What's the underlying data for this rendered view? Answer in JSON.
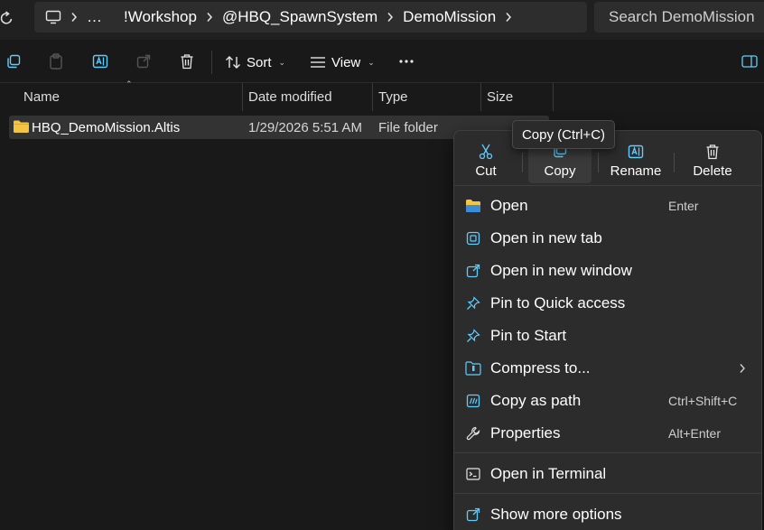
{
  "address_bar": {
    "crumbs": [
      "…",
      "!Workshop",
      "@HBQ_SpawnSystem",
      "DemoMission"
    ],
    "search_placeholder": "Search DemoMission"
  },
  "command_bar": {
    "sort_label": "Sort",
    "view_label": "View"
  },
  "columns": {
    "name": "Name",
    "date": "Date modified",
    "type": "Type",
    "size": "Size"
  },
  "files": [
    {
      "name": "HBQ_DemoMission.Altis",
      "date": "1/29/2026 5:51 AM",
      "type": "File folder",
      "size": ""
    }
  ],
  "context_menu": {
    "quick_actions": [
      {
        "label": "Cut",
        "icon": "scissors-icon"
      },
      {
        "label": "Copy",
        "icon": "copy-icon"
      },
      {
        "label": "Rename",
        "icon": "rename-icon"
      },
      {
        "label": "Delete",
        "icon": "trash-icon"
      }
    ],
    "items": [
      {
        "label": "Open",
        "shortcut": "Enter",
        "icon": "folder-open-icon"
      },
      {
        "label": "Open in new tab",
        "shortcut": "",
        "icon": "new-tab-icon"
      },
      {
        "label": "Open in new window",
        "shortcut": "",
        "icon": "new-window-icon"
      },
      {
        "label": "Pin to Quick access",
        "shortcut": "",
        "icon": "pin-icon"
      },
      {
        "label": "Pin to Start",
        "shortcut": "",
        "icon": "pin-icon"
      },
      {
        "label": "Compress to...",
        "shortcut": "",
        "icon": "zip-folder-icon"
      },
      {
        "label": "Copy as path",
        "shortcut": "Ctrl+Shift+C",
        "icon": "copy-path-icon"
      },
      {
        "label": "Properties",
        "shortcut": "Alt+Enter",
        "icon": "wrench-icon"
      },
      {
        "label": "Open in Terminal",
        "shortcut": "",
        "icon": "terminal-icon"
      },
      {
        "label": "Show more options",
        "shortcut": "",
        "icon": "more-options-icon"
      }
    ]
  },
  "tooltip": {
    "text": "Copy (Ctrl+C)"
  },
  "colors": {
    "background": "#191919",
    "menu_bg": "#2c2c2c",
    "accent_blue": "#60cdff",
    "folder_yellow": "#f4c542"
  }
}
